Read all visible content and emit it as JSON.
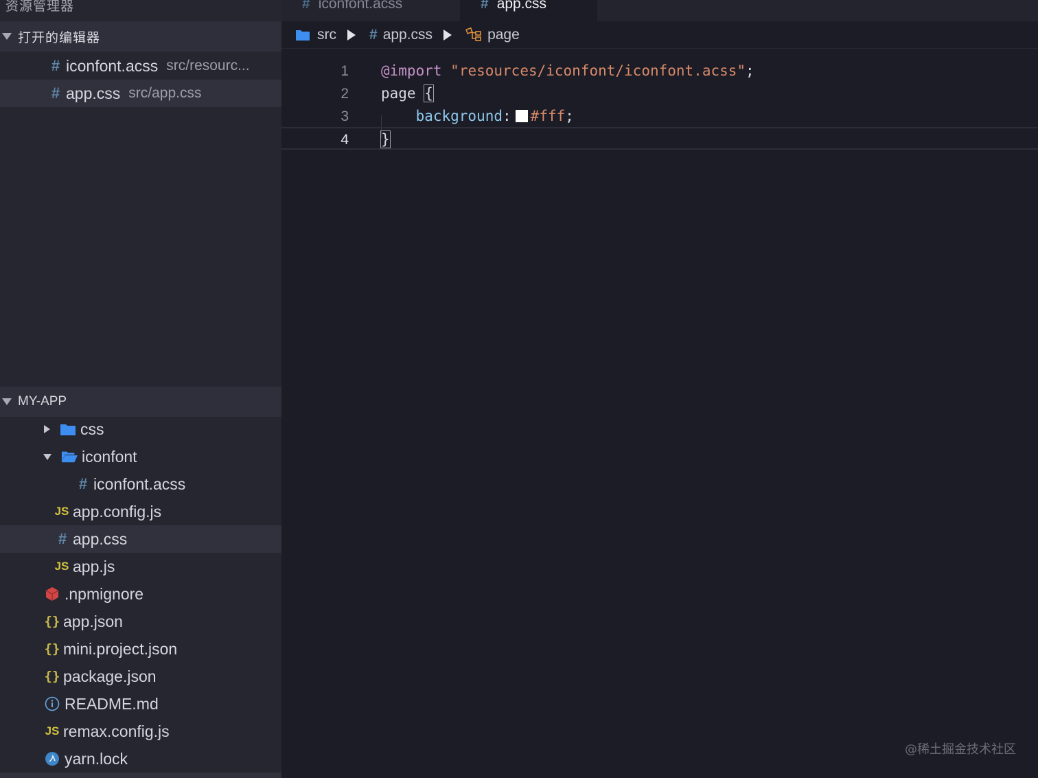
{
  "sidebar": {
    "title": "资源管理器",
    "open_editors": {
      "header": "打开的编辑器",
      "items": [
        {
          "name": "iconfont.acss",
          "path": "src/resourc..."
        },
        {
          "name": "app.css",
          "path": "src/app.css"
        }
      ]
    },
    "project": {
      "header": "MY-APP",
      "items": [
        {
          "label": "css"
        },
        {
          "label": "iconfont"
        },
        {
          "label": "iconfont.acss"
        },
        {
          "label": "app.config.js"
        },
        {
          "label": "app.css"
        },
        {
          "label": "app.js"
        },
        {
          "label": ".npmignore"
        },
        {
          "label": "app.json"
        },
        {
          "label": "mini.project.json"
        },
        {
          "label": "package.json"
        },
        {
          "label": "README.md"
        },
        {
          "label": "remax.config.js"
        },
        {
          "label": "yarn.lock"
        }
      ]
    }
  },
  "tabs": [
    {
      "label": "iconfont.acss",
      "icon": "hash-icon"
    },
    {
      "label": "app.css",
      "icon": "hash-icon",
      "active": true
    }
  ],
  "breadcrumb": {
    "folder": "src",
    "file": "app.css",
    "symbol": "page"
  },
  "editor": {
    "lines": [
      {
        "n": "1",
        "import_kw": "@import",
        "import_path": "\"resources/iconfont/iconfont.acss\"",
        "semi": ";"
      },
      {
        "n": "2",
        "selector": "page",
        "open": "{"
      },
      {
        "n": "3",
        "prop": "background",
        "colon": ":",
        "value": "#fff",
        "semi": ";"
      },
      {
        "n": "4",
        "close": "}"
      }
    ]
  },
  "colors": {
    "folder": "#3d8ef0",
    "hash": "#5f87a8",
    "js": "#d3c23e",
    "npmignore": "#d24545",
    "swatch": "#ffffff"
  },
  "watermark": "@稀土掘金技术社区"
}
